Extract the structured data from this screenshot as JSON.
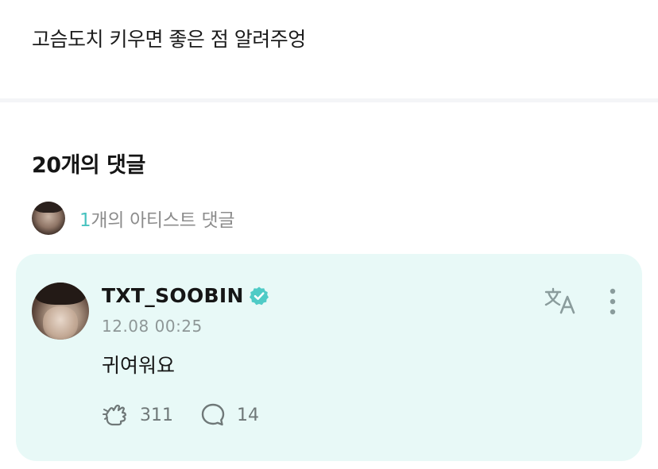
{
  "post": {
    "body": "고슴도치 키우면 좋은 점 알려주엉"
  },
  "comments_header": {
    "title": "20개의 댓글"
  },
  "artist_comments": {
    "count": "1",
    "label": "개의 아티스트 댓글"
  },
  "comment": {
    "author": "TXT_SOOBIN",
    "timestamp": "12.08 00:25",
    "text": "귀여워요",
    "likes": "311",
    "replies": "14"
  },
  "colors": {
    "accent": "#47c2bf",
    "card_background": "#e8f9f7",
    "verified_badge": "#4fcbc6"
  },
  "icons": {
    "verified": "verified-badge-icon",
    "translate": "translate-icon",
    "more": "more-options-icon",
    "like": "cheer-hand-icon",
    "reply": "speech-bubble-icon"
  }
}
